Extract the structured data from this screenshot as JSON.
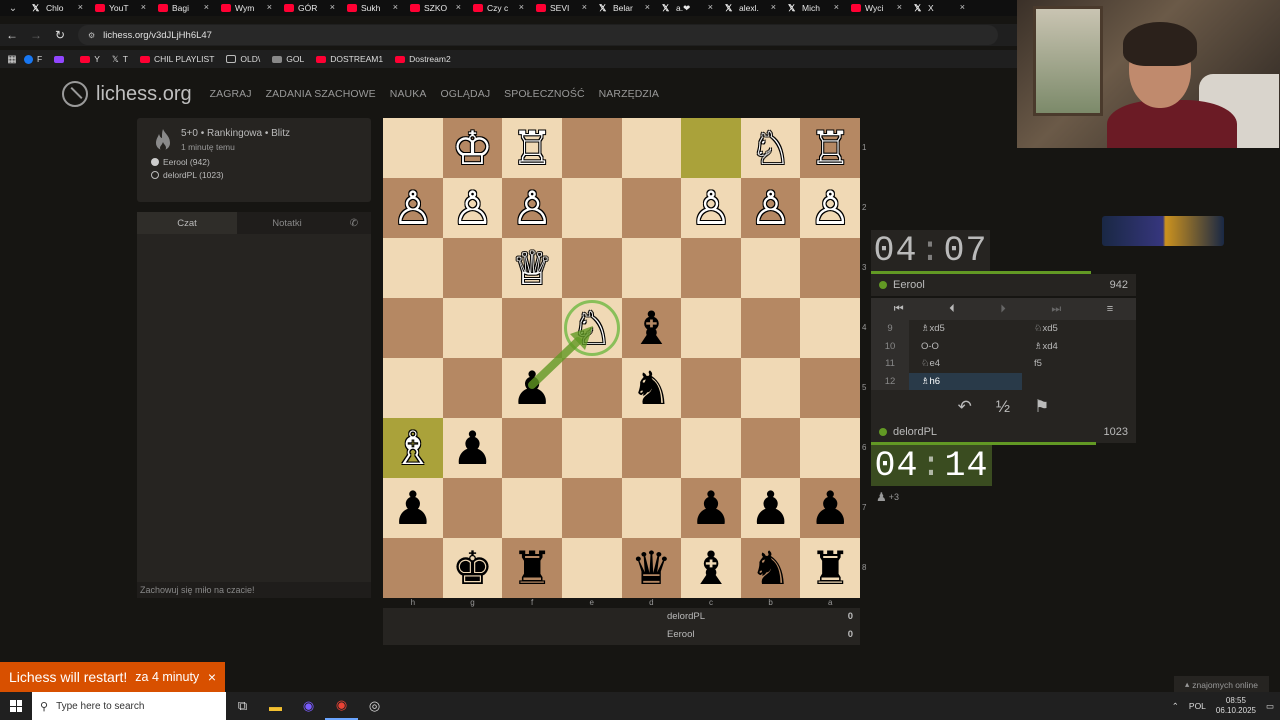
{
  "browser": {
    "tabs": [
      {
        "label": "Chlo",
        "icon": "x"
      },
      {
        "label": "YouT",
        "icon": "yt"
      },
      {
        "label": "Bagi",
        "icon": "yt"
      },
      {
        "label": "Wym",
        "icon": "yt"
      },
      {
        "label": "GÓR",
        "icon": "yt"
      },
      {
        "label": "Sukh",
        "icon": "yt"
      },
      {
        "label": "SZKO",
        "icon": "yt"
      },
      {
        "label": "Czy c",
        "icon": "yt"
      },
      {
        "label": "SEVI",
        "icon": "yt"
      },
      {
        "label": "Belar",
        "icon": "x"
      },
      {
        "label": "a.❤",
        "icon": "x"
      },
      {
        "label": "alexl.",
        "icon": "x"
      },
      {
        "label": "Mich",
        "icon": "x"
      },
      {
        "label": "Wyci",
        "icon": "yt"
      },
      {
        "label": "X",
        "icon": "x"
      }
    ],
    "url": "lichess.org/v3dJLjHh6L47",
    "bookmarks": [
      {
        "label": "F",
        "icon": "blue"
      },
      {
        "label": "",
        "icon": "purple"
      },
      {
        "label": "Y",
        "icon": "red"
      },
      {
        "label": "T",
        "icon": "x"
      },
      {
        "label": "CHIL PLAYLIST",
        "icon": "red"
      },
      {
        "label": "OLD\\",
        "icon": "folder"
      },
      {
        "label": "GOL",
        "icon": "gray"
      },
      {
        "label": "DOSTREAM1",
        "icon": "red"
      },
      {
        "label": "Dostream2",
        "icon": "red"
      }
    ]
  },
  "site": {
    "logo": "lichess.org",
    "nav": [
      "ZAGRAJ",
      "ZADANIA SZACHOWE",
      "NAUKA",
      "OGLĄDAJ",
      "SPOŁECZNOŚĆ",
      "NARZĘDZIA"
    ]
  },
  "game": {
    "title": "5+0 • Rankingowa • Blitz",
    "time_ago": "1 minutę temu",
    "white": "Eerool (942)",
    "black": "delordPL (1023)"
  },
  "chat": {
    "tab_chat": "Czat",
    "tab_notes": "Notatki",
    "footer": "Zachowuj się miło na czacie!"
  },
  "board": {
    "orientation": "black",
    "ranks_top_to_bottom": [
      "1",
      "2",
      "3",
      "4",
      "5",
      "6",
      "7",
      "8"
    ],
    "files_left_to_right": [
      "h",
      "g",
      "f",
      "e",
      "d",
      "c",
      "b",
      "a"
    ],
    "squares": [
      [
        "",
        "wK",
        "wR",
        "",
        "",
        "",
        "wN",
        "wR"
      ],
      [
        "wP",
        "wP",
        "wP",
        "",
        "",
        "wP",
        "wP",
        "wP"
      ],
      [
        "",
        "",
        "wQ",
        "",
        "",
        "",
        "",
        ""
      ],
      [
        "",
        "",
        "",
        "wN",
        "bB",
        "",
        "",
        ""
      ],
      [
        "",
        "",
        "bP",
        "",
        "bN",
        "",
        "",
        ""
      ],
      [
        "wB",
        "bP",
        "",
        "",
        "",
        "",
        "",
        ""
      ],
      [
        "bP",
        "",
        "",
        "",
        "",
        "bP",
        "bP",
        "bP"
      ],
      [
        "",
        "bK",
        "bR",
        "",
        "bQ",
        "bB",
        "bN",
        "bR"
      ]
    ],
    "last_move_squares": [
      "h6",
      "c1"
    ],
    "arrow": {
      "from": "f5",
      "to": "e4",
      "color": "#629924"
    }
  },
  "players_score": [
    {
      "name": "delordPL",
      "score": "0"
    },
    {
      "name": "Eerool",
      "score": "0"
    }
  ],
  "clocks": {
    "top": {
      "min": "04",
      "sec": "07",
      "fill": 0.75
    },
    "bottom": {
      "min": "04",
      "sec": "14",
      "fill": 0.85
    }
  },
  "top_player": {
    "name": "Eerool",
    "rating": "942"
  },
  "bottom_player": {
    "name": "delordPL",
    "rating": "1023"
  },
  "moves": [
    {
      "n": "9",
      "w": "♗xd5",
      "b": "♘xd5"
    },
    {
      "n": "10",
      "w": "O-O",
      "b": "♗xd4"
    },
    {
      "n": "11",
      "w": "♘e4",
      "b": "f5"
    },
    {
      "n": "12",
      "w": "♗h6",
      "b": ""
    }
  ],
  "material": "+3",
  "notification": {
    "title": "Lichess will restart!",
    "when": "za 4 minuty"
  },
  "friends": "znajomych online",
  "taskbar": {
    "search": "Type here to search",
    "lang": "POL",
    "time": "08:55",
    "date": "06.10.2025"
  }
}
